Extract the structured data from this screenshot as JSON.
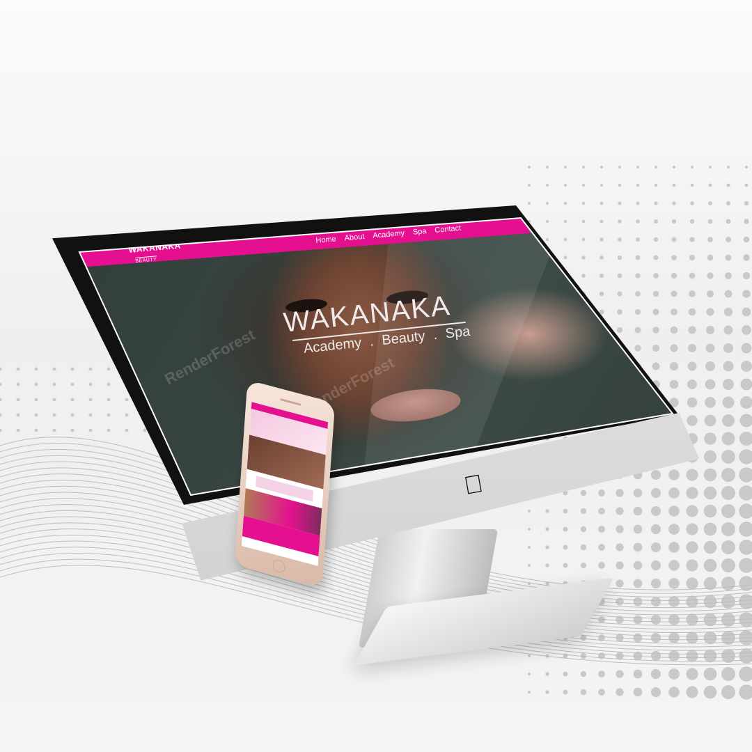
{
  "site": {
    "brand": "WAKANAKA",
    "brand_sub": "BEAUTY",
    "nav": [
      "Home",
      "About",
      "Academy",
      "Spa",
      "Contact"
    ],
    "hero_title": "WAKANAKA",
    "hero_sub": [
      "Academy",
      ".",
      "Beauty",
      ".",
      "Spa"
    ]
  },
  "watermark": "RenderForest",
  "colors": {
    "accent": "#e5108f",
    "bezel": "#111111",
    "background": "#f2f2f2"
  },
  "icons": {
    "apple": "apple-logo-icon"
  }
}
